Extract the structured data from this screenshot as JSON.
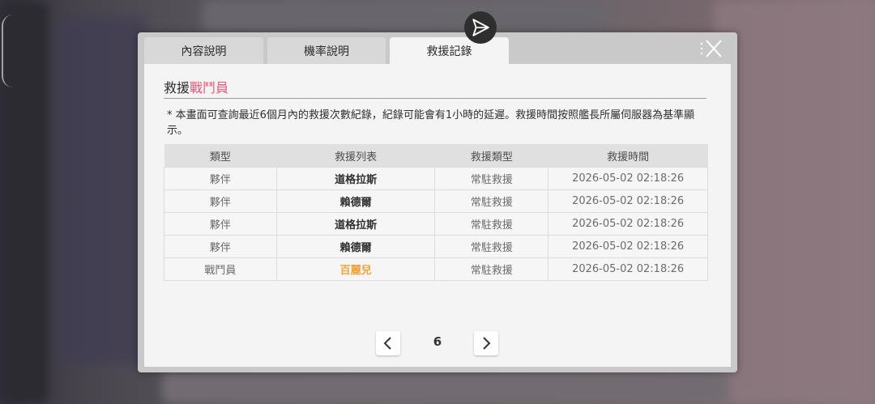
{
  "tabs": [
    {
      "label": "內容說明",
      "active": false
    },
    {
      "label": "機率說明",
      "active": false
    },
    {
      "label": "救援記錄",
      "active": true
    }
  ],
  "section_title": {
    "prefix": "救援",
    "highlight": "戰鬥員"
  },
  "note": "* 本畫面可查詢最近6個月內的救援次數紀錄，紀錄可能會有1小時的延遲。救援時間按照艦長所屬伺服器為基準顯示。",
  "table": {
    "headers": [
      "類型",
      "救援列表",
      "救援類型",
      "救援時間"
    ],
    "rows": [
      {
        "type": "夥伴",
        "name": "道格拉斯",
        "rescue_type": "常駐救援",
        "time": "2026-05-02 02:18:26",
        "name_color": "#2f2f2f"
      },
      {
        "type": "夥伴",
        "name": "賴德爾",
        "rescue_type": "常駐救援",
        "time": "2026-05-02 02:18:26",
        "name_color": "#2f2f2f"
      },
      {
        "type": "夥伴",
        "name": "道格拉斯",
        "rescue_type": "常駐救援",
        "time": "2026-05-02 02:18:26",
        "name_color": "#2f2f2f"
      },
      {
        "type": "夥伴",
        "name": "賴德爾",
        "rescue_type": "常駐救援",
        "time": "2026-05-02 02:18:26",
        "name_color": "#2f2f2f"
      },
      {
        "type": "戰鬥員",
        "name": "百麗兒",
        "rescue_type": "常駐救援",
        "time": "2026-05-02 02:18:26",
        "name_color": "#f0a33a"
      }
    ]
  },
  "pagination": {
    "current_page": "6"
  },
  "icons": {
    "close": "close-x-icon",
    "prev": "chevron-left-icon",
    "next": "chevron-right-icon",
    "top": "send-arrow-icon"
  },
  "colors": {
    "highlight": "#e6597a",
    "gold": "#f0a33a"
  }
}
